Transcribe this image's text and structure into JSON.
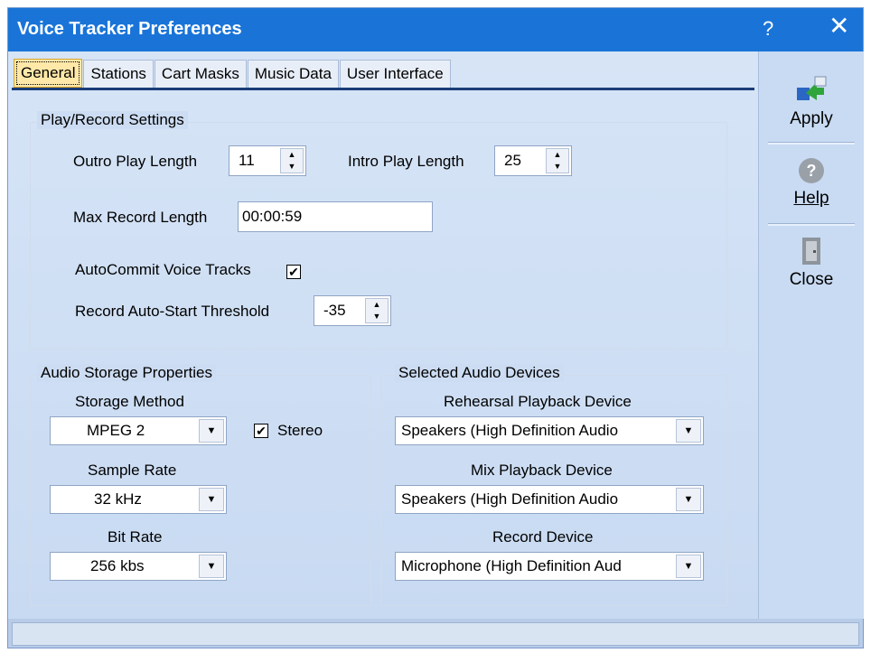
{
  "window": {
    "title": "Voice Tracker Preferences",
    "help_glyph": "?",
    "close_glyph": "✕"
  },
  "tabs": [
    {
      "label": "General",
      "active": true
    },
    {
      "label": "Stations"
    },
    {
      "label": "Cart Masks"
    },
    {
      "label": "Music Data"
    },
    {
      "label": "User Interface"
    }
  ],
  "play_record": {
    "group_label": "Play/Record Settings",
    "outro_label": "Outro Play Length",
    "outro_value": "11",
    "intro_label": "Intro Play Length",
    "intro_value": "25",
    "max_record_label": "Max Record Length",
    "max_record_value": "00:00:59",
    "autocommit_label": "AutoCommit Voice Tracks",
    "autocommit_checked": true,
    "threshold_label": "Record Auto-Start Threshold",
    "threshold_value": "-35"
  },
  "audio_storage": {
    "group_label": "Audio Storage Properties",
    "storage_method_label": "Storage Method",
    "storage_method_value": "MPEG 2",
    "stereo_label": "Stereo",
    "stereo_checked": true,
    "sample_rate_label": "Sample Rate",
    "sample_rate_value": "32 kHz",
    "bit_rate_label": "Bit Rate",
    "bit_rate_value": "256 kbs"
  },
  "audio_devices": {
    "group_label": "Selected Audio Devices",
    "rehearsal_label": "Rehearsal Playback Device",
    "rehearsal_value": "Speakers (High Definition Audio",
    "mix_label": "Mix Playback Device",
    "mix_value": "Speakers (High Definition Audio",
    "record_label": "Record Device",
    "record_value": "Microphone (High Definition Aud"
  },
  "side": {
    "apply_label": "Apply",
    "help_label": "Help",
    "close_label": "Close"
  },
  "colors": {
    "titlebar": "#1a74d8",
    "accent_tab": "#ffe8a8"
  }
}
